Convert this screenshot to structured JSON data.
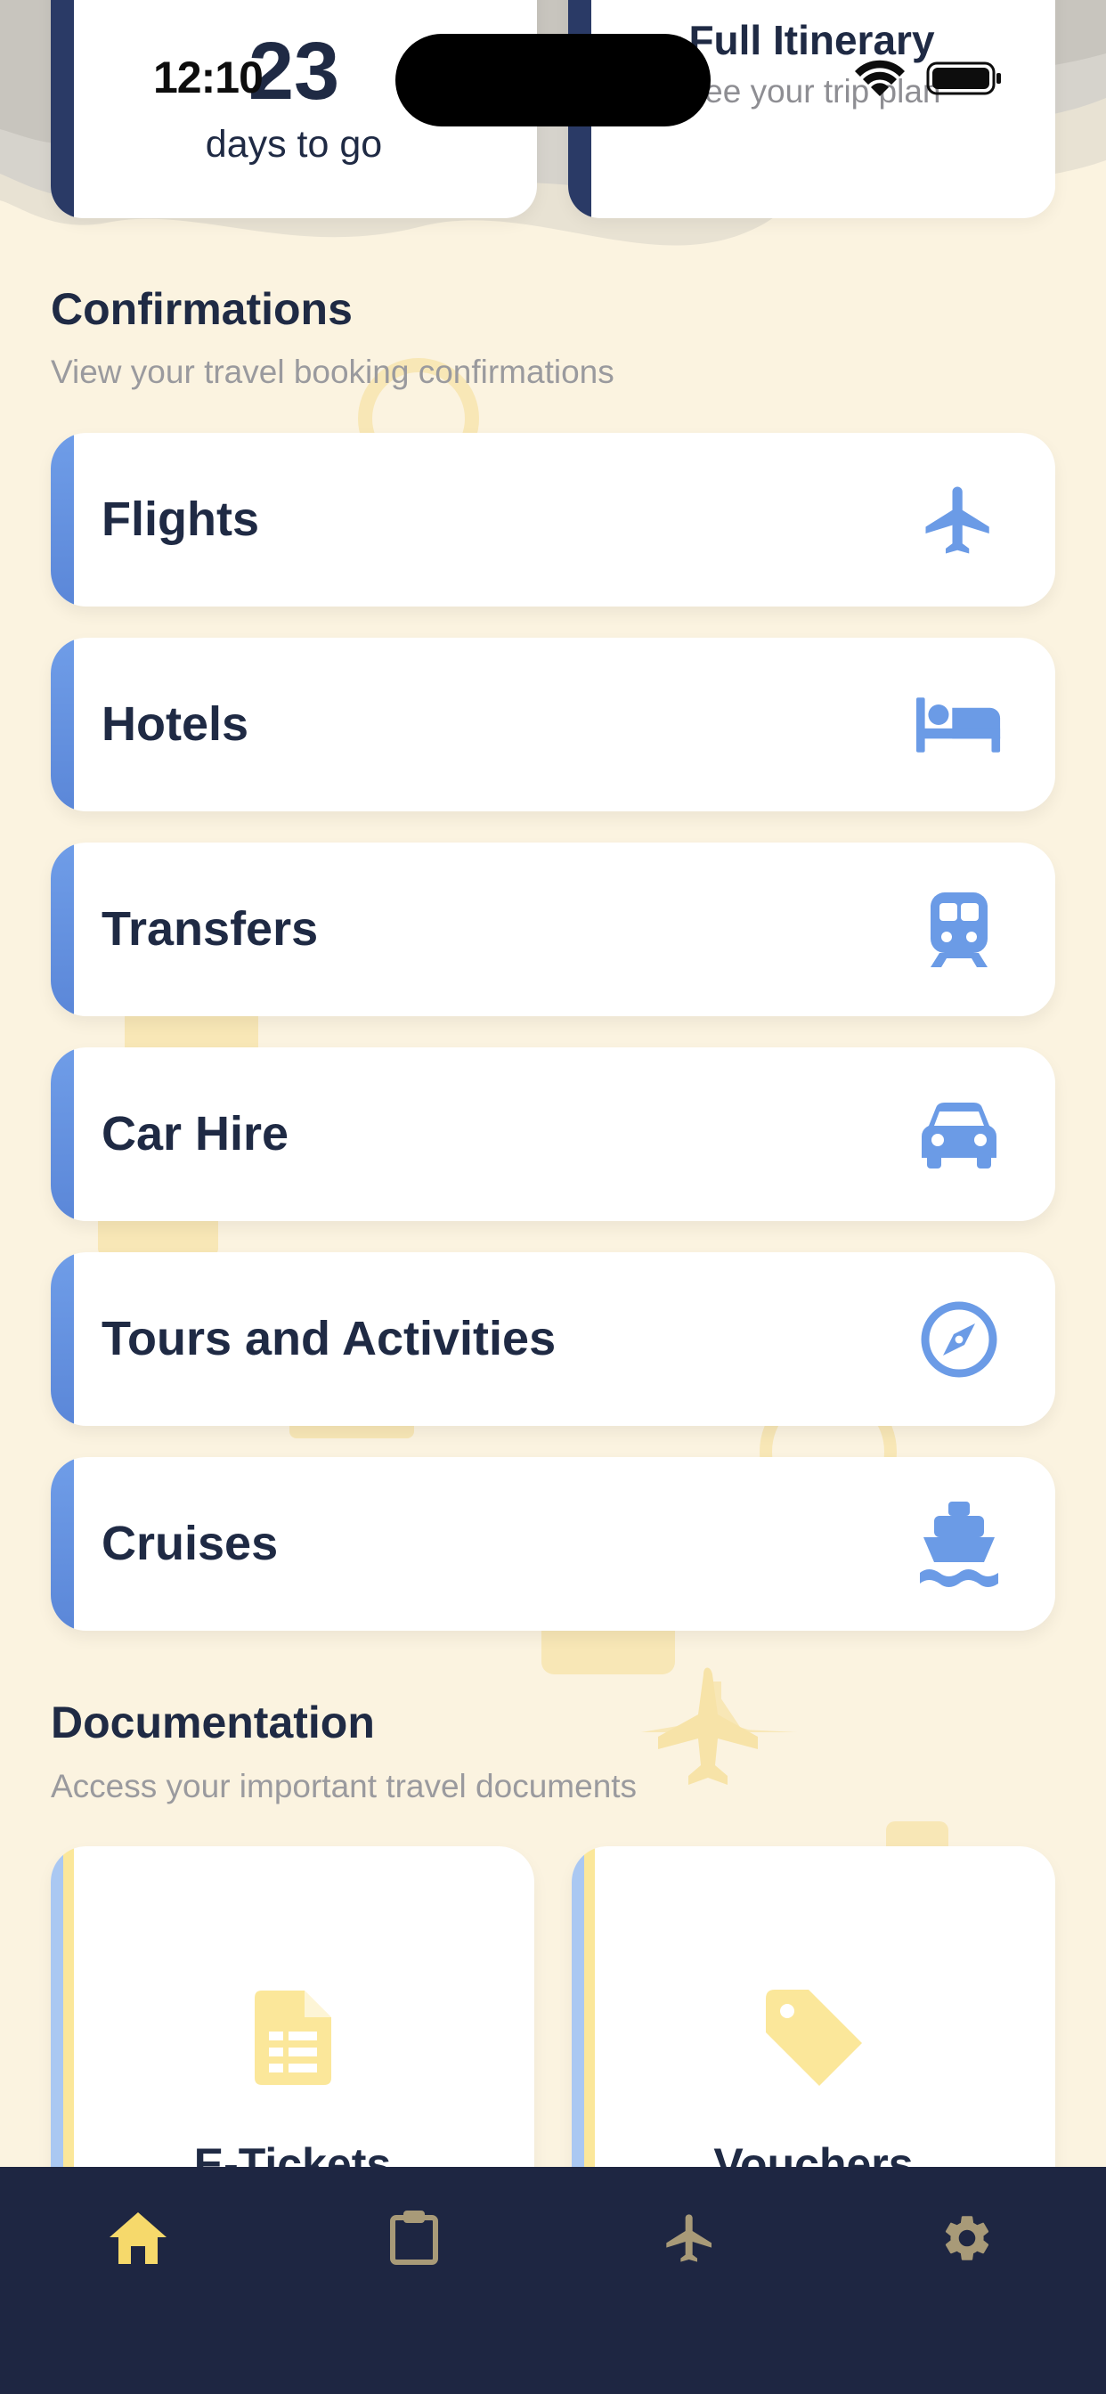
{
  "status_bar": {
    "time": "12:10"
  },
  "countdown": {
    "number": "23",
    "label": "days to go"
  },
  "itinerary": {
    "title": "Full Itinerary",
    "subtitle": "See your trip plan"
  },
  "confirmations": {
    "title": "Confirmations",
    "subtitle": "View your travel booking confirmations",
    "items": [
      {
        "label": "Flights",
        "icon": "airplane-icon"
      },
      {
        "label": "Hotels",
        "icon": "bed-icon"
      },
      {
        "label": "Transfers",
        "icon": "train-icon"
      },
      {
        "label": "Car Hire",
        "icon": "car-icon"
      },
      {
        "label": "Tours and Activities",
        "icon": "compass-icon"
      },
      {
        "label": "Cruises",
        "icon": "ship-icon"
      }
    ]
  },
  "documentation": {
    "title": "Documentation",
    "subtitle": "Access your important travel documents",
    "items": [
      {
        "label": "E-Tickets",
        "icon": "document-icon"
      },
      {
        "label": "Vouchers",
        "icon": "tag-icon"
      }
    ]
  },
  "tab_bar": {
    "tabs": [
      {
        "name": "home-icon",
        "active": true
      },
      {
        "name": "clipboard-icon",
        "active": false
      },
      {
        "name": "airplane-icon",
        "active": false
      },
      {
        "name": "gear-icon",
        "active": false
      }
    ]
  },
  "colors": {
    "accent_blue": "#5b87d8",
    "navy": "#1f2a44",
    "tab_active": "#f6d96b",
    "tab_inactive": "#a89a78",
    "background": "#fbf3e0"
  }
}
